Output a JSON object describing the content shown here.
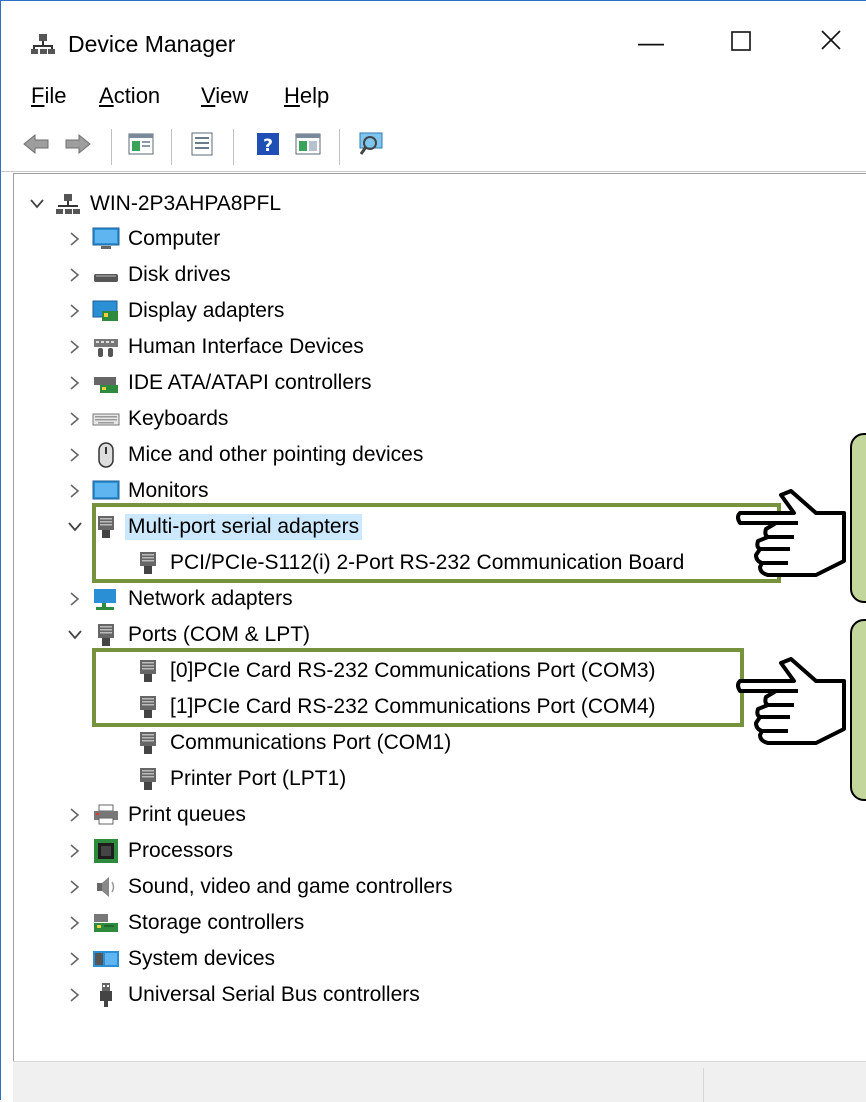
{
  "window": {
    "title": "Device Manager",
    "minimize_glyph": "—",
    "maximize_glyph": "☐",
    "close_glyph": "✕"
  },
  "menu": [
    {
      "accel": "F",
      "rest": "ile"
    },
    {
      "accel": "A",
      "rest": "ction"
    },
    {
      "accel": "V",
      "rest": "iew"
    },
    {
      "accel": "H",
      "rest": "elp"
    }
  ],
  "toolbar": [
    "back-icon",
    "forward-icon",
    "properties-pane-icon",
    "properties-icon",
    "help-icon",
    "update-driver-icon",
    "scan-hardware-icon"
  ],
  "tree": {
    "root": "WIN-2P3AHPA8PFL",
    "items": [
      {
        "label": "Computer",
        "icon": "computer-icon",
        "expanded": false
      },
      {
        "label": "Disk drives",
        "icon": "disk-drive-icon",
        "expanded": false
      },
      {
        "label": "Display adapters",
        "icon": "display-adapter-icon",
        "expanded": false
      },
      {
        "label": "Human Interface Devices",
        "icon": "hid-icon",
        "expanded": false
      },
      {
        "label": "IDE ATA/ATAPI controllers",
        "icon": "ide-controller-icon",
        "expanded": false
      },
      {
        "label": "Keyboards",
        "icon": "keyboard-icon",
        "expanded": false
      },
      {
        "label": "Mice and other pointing devices",
        "icon": "mouse-icon",
        "expanded": false
      },
      {
        "label": "Monitors",
        "icon": "monitor-icon",
        "expanded": false
      },
      {
        "label": "Multi-port serial adapters",
        "icon": "serial-port-icon",
        "expanded": true,
        "selected": true,
        "children": [
          "PCI/PCIe-S112(i) 2-Port RS-232 Communication Board"
        ]
      },
      {
        "label": "Network adapters",
        "icon": "network-adapter-icon",
        "expanded": false
      },
      {
        "label": "Ports (COM & LPT)",
        "icon": "port-icon",
        "expanded": true,
        "children": [
          "[0]PCIe Card RS-232 Communications Port (COM3)",
          "[1]PCIe Card RS-232 Communications Port (COM4)",
          "Communications Port (COM1)",
          "Printer Port (LPT1)"
        ]
      },
      {
        "label": "Print queues",
        "icon": "printer-icon",
        "expanded": false
      },
      {
        "label": "Processors",
        "icon": "processor-icon",
        "expanded": false
      },
      {
        "label": "Sound, video and game controllers",
        "icon": "speaker-icon",
        "expanded": false
      },
      {
        "label": "Storage controllers",
        "icon": "storage-controller-icon",
        "expanded": false
      },
      {
        "label": "System devices",
        "icon": "system-device-icon",
        "expanded": false
      },
      {
        "label": "Universal Serial Bus controllers",
        "icon": "usb-icon",
        "expanded": false
      }
    ]
  },
  "colors": {
    "highlight_border": "#76923c",
    "callout_fill": "#c3d69b",
    "selection": "#cce8ff",
    "title_border": "#2f70c7"
  }
}
